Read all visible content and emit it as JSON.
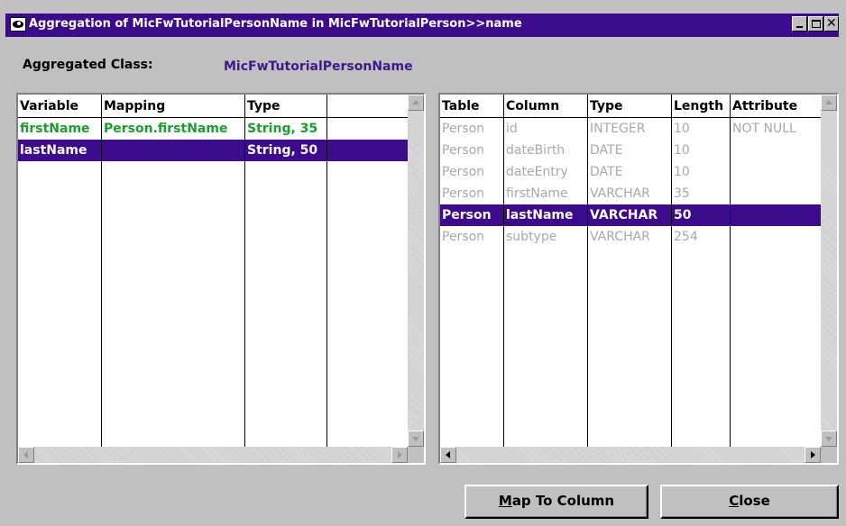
{
  "window": {
    "title": "Aggregation of MicFwTutorialPersonName in MicFwTutorialPerson>>name",
    "controls": {
      "minimize": "minimize-icon",
      "maximize": "maximize-icon",
      "close": "close-icon"
    }
  },
  "aggregated": {
    "label": "Aggregated Class:",
    "value": "MicFwTutorialPersonName"
  },
  "left_table": {
    "headers": [
      "Variable",
      "Mapping",
      "Type",
      ""
    ],
    "rows": [
      {
        "variable": "firstName",
        "mapping": "Person.firstName",
        "type": "String, 35",
        "extra": "",
        "selected": false
      },
      {
        "variable": "lastName",
        "mapping": "",
        "type": "String, 50",
        "extra": "",
        "selected": true
      }
    ]
  },
  "right_table": {
    "headers": [
      "Table",
      "Column",
      "Type",
      "Length",
      "Attribute"
    ],
    "rows": [
      {
        "table": "Person",
        "column": "id",
        "type": "INTEGER",
        "length": "10",
        "attribute": "NOT NULL",
        "selected": false
      },
      {
        "table": "Person",
        "column": "dateBirth",
        "type": "DATE",
        "length": "10",
        "attribute": "",
        "selected": false
      },
      {
        "table": "Person",
        "column": "dateEntry",
        "type": "DATE",
        "length": "10",
        "attribute": "",
        "selected": false
      },
      {
        "table": "Person",
        "column": "firstName",
        "type": "VARCHAR",
        "length": "35",
        "attribute": "",
        "selected": false
      },
      {
        "table": "Person",
        "column": "lastName",
        "type": "VARCHAR",
        "length": "50",
        "attribute": "",
        "selected": true
      },
      {
        "table": "Person",
        "column": "subtype",
        "type": "VARCHAR",
        "length": "254",
        "attribute": "",
        "selected": false
      }
    ]
  },
  "buttons": {
    "map_prefix": "M",
    "map_rest": "ap To Column",
    "close_prefix": "C",
    "close_rest": "lose"
  },
  "colors": {
    "title_bar": "#3c0a8c",
    "selection": "#3c0a8c",
    "mapped_text": "#1a9e2c",
    "class_name": "#3c1a8c",
    "unmapped_text": "#a8a8a8"
  }
}
